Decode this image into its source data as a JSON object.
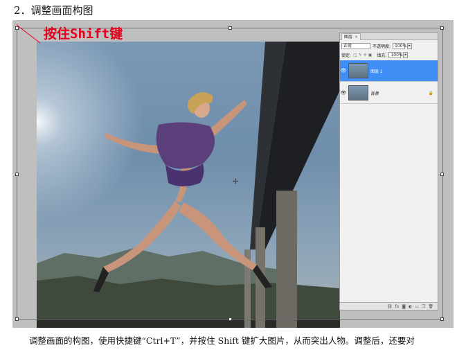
{
  "heading": "2．调整画面构图",
  "annotation": "按住Shift键",
  "caption": "调整画面的构图，使用快捷键“Ctrl+T”，并按住 Shift 键扩大图片，从而突出人物。调整后，还要对",
  "layers_panel": {
    "tab_label": "图层",
    "close_glyph": "×",
    "blend_mode": "正常",
    "opacity_label": "不透明度:",
    "opacity_value": "100%",
    "lock_label": "锁定:",
    "fill_label": "填充:",
    "fill_value": "100%",
    "layers": [
      {
        "name": "图层 1",
        "selected": true
      },
      {
        "name": "背景",
        "selected": false,
        "locked": true
      }
    ],
    "footer_icons": [
      "link-icon",
      "fx-icon",
      "mask-icon",
      "adjustment-icon",
      "group-icon",
      "new-layer-icon",
      "trash-icon"
    ]
  },
  "colors": {
    "annotation": "#e3001b",
    "selected_layer": "#3f8ff6",
    "canvas_gray": "#bfbfbf"
  }
}
